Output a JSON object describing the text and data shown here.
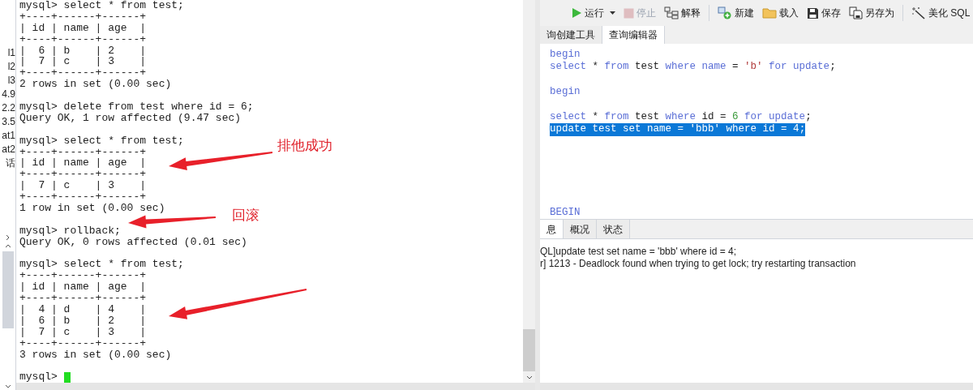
{
  "sidebar_stub": {
    "labels": [
      "l1",
      "l2",
      "l3",
      "4.9",
      "2.2",
      "3.5",
      "at1",
      "at2",
      "话"
    ]
  },
  "terminal": {
    "blocks": [
      {
        "lines": [
          "mysql> select * from test;",
          "+----+------+------+",
          "| id | name | age  |",
          "+----+------+------+",
          "|  6 | b    | 2    |",
          "|  7 | c    | 3    |",
          "+----+------+------+",
          "2 rows in set (0.00 sec)"
        ]
      },
      {
        "lines": [
          "mysql> delete from test where id = 6;",
          "Query OK, 1 row affected (9.47 sec)"
        ]
      },
      {
        "lines": [
          "mysql> select * from test;",
          "+----+------+------+",
          "| id | name | age  |",
          "+----+------+------+",
          "|  7 | c    | 3    |",
          "+----+------+------+",
          "1 row in set (0.00 sec)"
        ]
      },
      {
        "lines": [
          "mysql> rollback;",
          "Query OK, 0 rows affected (0.01 sec)"
        ]
      },
      {
        "lines": [
          "mysql> select * from test;",
          "+----+------+------+",
          "| id | name | age  |",
          "+----+------+------+",
          "|  4 | d    | 4    |",
          "|  6 | b    | 2    |",
          "|  7 | c    | 3    |",
          "+----+------+------+",
          "3 rows in set (0.00 sec)"
        ]
      },
      {
        "lines": [
          "mysql>"
        ]
      }
    ],
    "cursor": true
  },
  "annotations": [
    {
      "label": "排他成功"
    },
    {
      "label": "回滚"
    }
  ],
  "toolbar": {
    "buttons": [
      {
        "label": "运行",
        "dropdown": true,
        "disabled": false
      },
      {
        "label": "停止",
        "dropdown": false,
        "disabled": true
      },
      {
        "label": "解释",
        "dropdown": false,
        "disabled": false
      },
      {
        "label": "新建",
        "dropdown": false,
        "disabled": false
      },
      {
        "label": "载入",
        "dropdown": false,
        "disabled": false
      },
      {
        "label": "保存",
        "dropdown": false,
        "disabled": false
      },
      {
        "label": "另存为",
        "dropdown": false,
        "disabled": false
      },
      {
        "label": "美化 SQL",
        "dropdown": false,
        "disabled": false
      }
    ]
  },
  "editor_tabs": [
    {
      "label": "询创建工具",
      "selected": false
    },
    {
      "label": "查询编辑器",
      "selected": true
    }
  ],
  "editor": {
    "blocks": [
      {
        "lines": [
          {
            "selected": false,
            "tokens": [
              {
                "kind": "keyword",
                "text": "begin"
              }
            ]
          },
          {
            "selected": false,
            "tokens": [
              {
                "kind": "keyword",
                "text": "select"
              },
              {
                "kind": "plain",
                "text": " * "
              },
              {
                "kind": "keyword",
                "text": "from"
              },
              {
                "kind": "plain",
                "text": " test "
              },
              {
                "kind": "keyword",
                "text": "where name"
              },
              {
                "kind": "plain",
                "text": " = "
              },
              {
                "kind": "string",
                "text": "'b'"
              },
              {
                "kind": "keyword",
                "text": " for update"
              },
              {
                "kind": "plain",
                "text": ";"
              }
            ]
          }
        ]
      },
      {
        "lines": [
          {
            "selected": false,
            "tokens": [
              {
                "kind": "keyword",
                "text": "begin"
              }
            ]
          }
        ]
      },
      {
        "lines": [
          {
            "selected": false,
            "tokens": [
              {
                "kind": "keyword",
                "text": "select"
              },
              {
                "kind": "plain",
                "text": " * "
              },
              {
                "kind": "keyword",
                "text": "from"
              },
              {
                "kind": "plain",
                "text": " test "
              },
              {
                "kind": "keyword",
                "text": "where"
              },
              {
                "kind": "plain",
                "text": " id = "
              },
              {
                "kind": "number",
                "text": "6"
              },
              {
                "kind": "keyword",
                "text": " for update"
              },
              {
                "kind": "plain",
                "text": ";"
              }
            ]
          },
          {
            "selected": true,
            "tokens": [
              {
                "kind": "keyword",
                "text": "update"
              },
              {
                "kind": "plain",
                "text": " test "
              },
              {
                "kind": "keyword",
                "text": "set name"
              },
              {
                "kind": "plain",
                "text": " = "
              },
              {
                "kind": "string",
                "text": "'bbb'"
              },
              {
                "kind": "keyword",
                "text": " where"
              },
              {
                "kind": "plain",
                "text": " id = "
              },
              {
                "kind": "number",
                "text": "4"
              },
              {
                "kind": "plain",
                "text": ";"
              }
            ]
          }
        ]
      },
      {
        "lines": [
          {
            "selected": false,
            "tokens": [
              {
                "kind": "keyword",
                "text": "BEGIN"
              }
            ]
          }
        ]
      }
    ]
  },
  "result_tabs": [
    {
      "label": "息",
      "selected": true
    },
    {
      "label": "概况",
      "selected": false
    },
    {
      "label": "状态",
      "selected": false
    }
  ],
  "messages": [
    "QL]update test set name = 'bbb' where id = 4;",
    "r] 1213 - Deadlock found when trying to get lock; try restarting transaction"
  ]
}
